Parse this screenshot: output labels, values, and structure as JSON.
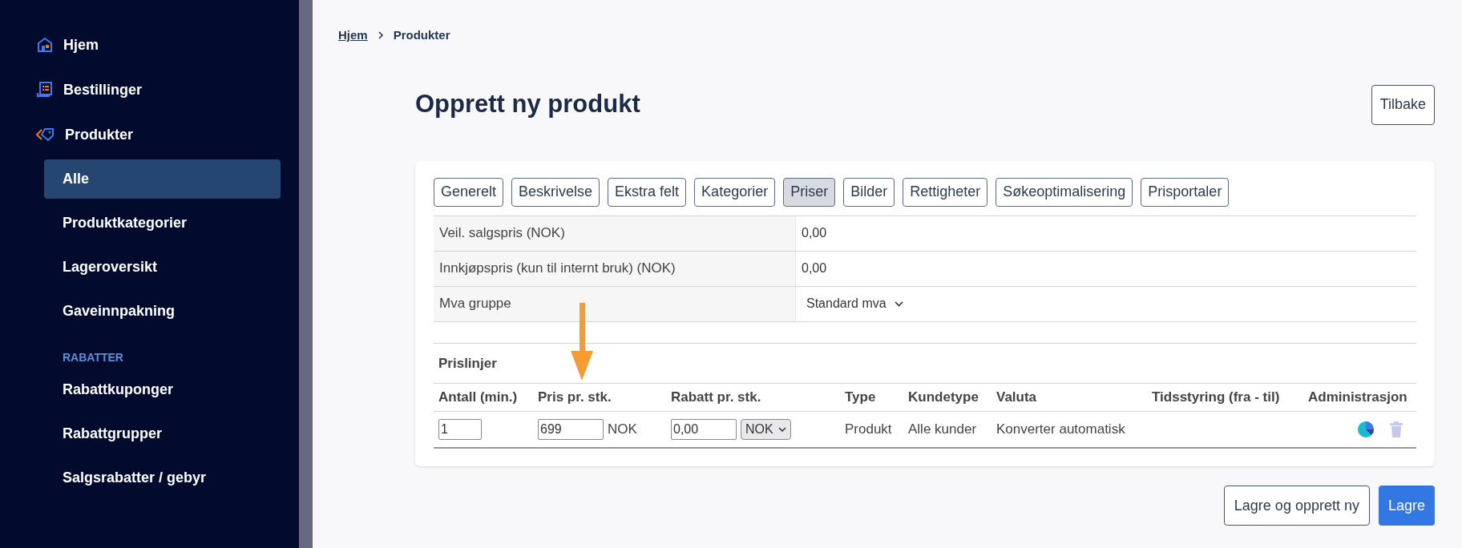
{
  "sidebar": {
    "items": [
      {
        "label": "Hjem",
        "selected": false
      },
      {
        "label": "Bestillinger",
        "selected": false
      },
      {
        "label": "Produkter",
        "selected": false,
        "children": [
          {
            "label": "Alle",
            "selected": true
          },
          {
            "label": "Produktkategorier",
            "selected": false
          },
          {
            "label": "Lageroversikt",
            "selected": false
          },
          {
            "label": "Gaveinnpakning",
            "selected": false
          }
        ]
      }
    ],
    "sections": [
      {
        "title": "RABATTER",
        "items": [
          {
            "label": "Rabattkuponger",
            "selected": false
          },
          {
            "label": "Rabattgrupper",
            "selected": false
          },
          {
            "label": "Salgsrabatter / gebyr",
            "selected": false
          }
        ]
      }
    ]
  },
  "breadcrumb": {
    "link": "Hjem",
    "current": "Produkter"
  },
  "page": {
    "title": "Opprett ny produkt",
    "back_button": "Tilbake"
  },
  "tabs": [
    {
      "label": "Generelt",
      "selected": false
    },
    {
      "label": "Beskrivelse",
      "selected": false
    },
    {
      "label": "Ekstra felt",
      "selected": false
    },
    {
      "label": "Kategorier",
      "selected": false
    },
    {
      "label": "Priser",
      "selected": true
    },
    {
      "label": "Bilder",
      "selected": false
    },
    {
      "label": "Rettigheter",
      "selected": false
    },
    {
      "label": "Søkeoptimalisering",
      "selected": false
    },
    {
      "label": "Prisportaler",
      "selected": false
    }
  ],
  "price_fields": [
    {
      "label": "Veil. salgspris (NOK)",
      "value": "0,00",
      "kind": "text"
    },
    {
      "label": "Innkjøpspris (kun til internt bruk) (NOK)",
      "value": "0,00",
      "kind": "text"
    },
    {
      "label": "Mva gruppe",
      "value": "Standard mva",
      "kind": "select"
    }
  ],
  "price_lines": {
    "title": "Prislinjer",
    "columns": [
      "Antall (min.)",
      "Pris pr. stk.",
      "Rabatt pr. stk.",
      "Type",
      "Kundetype",
      "Valuta",
      "Tidsstyring (fra - til)",
      "Administrasjon"
    ],
    "rows": [
      {
        "quantity": "1",
        "price": "699",
        "price_currency": "NOK",
        "discount": "0,00",
        "discount_currency": "NOK",
        "type": "Produkt",
        "customer_type": "Alle kunder",
        "currency": "Konverter automatisk"
      }
    ]
  },
  "actions": [
    "Lagre og opprett ny",
    "Lagre"
  ]
}
